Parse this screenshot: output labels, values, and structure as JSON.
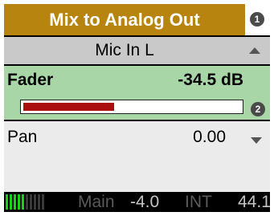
{
  "title": "Mix to Analog Out",
  "badges": {
    "one": "1",
    "two": "2"
  },
  "channel": {
    "label": "Mic In L"
  },
  "fader": {
    "label": "Fader",
    "value": "-34.5 dB",
    "level_fraction": 0.42
  },
  "pan": {
    "label": "Pan",
    "value": "0.00"
  },
  "status": {
    "meter_total_segments": 10,
    "meter_active_segments": 5,
    "main_label": "Main",
    "level": "-4.0",
    "sync": "INT",
    "rate": "44.1"
  },
  "colors": {
    "title_bg": "#b88410",
    "fader_panel_bg": "#a9d6a7",
    "fader_fill": "#aa0e0e",
    "meter_on": "#18d018"
  },
  "icons": {
    "channel_scroll": "up-arrow-icon",
    "pan_scroll": "down-arrow-icon"
  }
}
